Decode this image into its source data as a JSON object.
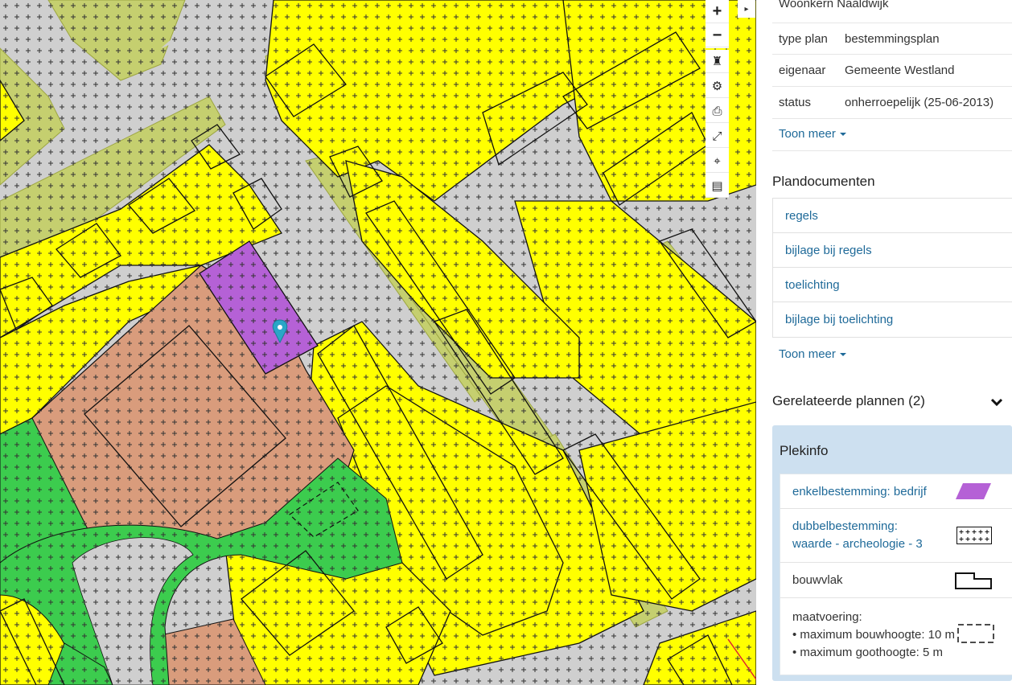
{
  "map": {
    "controls": [
      {
        "name": "zoom-in-button",
        "label": "+",
        "big": true
      },
      {
        "name": "zoom-out-button",
        "label": "−",
        "big": true
      },
      {
        "name": "castle-layer-button",
        "label": "♜",
        "big": false
      },
      {
        "name": "settings-button",
        "label": "⚙",
        "big": false
      },
      {
        "name": "print-button",
        "label": "⎙",
        "big": false
      },
      {
        "name": "fullscreen-button",
        "label": "⤢",
        "big": false
      },
      {
        "name": "locate-button",
        "label": "⌖",
        "big": false
      },
      {
        "name": "legend-button",
        "label": "▤",
        "big": false
      }
    ],
    "collapse_icon": "▸",
    "colors": {
      "road": "#cfcfcf",
      "residential": "#ffff00",
      "business": "#b561d6",
      "centre": "#d99c7c",
      "greenery": "#3ccc4e",
      "mixed": "#c5cf6a",
      "grid": "#333333",
      "outline": "#111111",
      "marker": "#2aa6c7"
    }
  },
  "panel": {
    "plan_name": "Woonkern Naaldwijk",
    "rows": [
      {
        "key": "type plan",
        "value": "bestemmingsplan"
      },
      {
        "key": "eigenaar",
        "value": "Gemeente Westland"
      },
      {
        "key": "status",
        "value": "onherroepelijk (25-06-2013)"
      }
    ],
    "toon_meer_1": "Toon meer",
    "plandocumenten_title": "Plandocumenten",
    "documents": [
      "regels",
      "bijlage bij regels",
      "toelichting",
      "bijlage bij toelichting"
    ],
    "toon_meer_2": "Toon meer",
    "related_title": "Gerelateerde plannen (2)",
    "plekinfo": {
      "title": "Plekinfo",
      "enkelbestemming": "enkelbestemming: bedrijf",
      "dubbel_line1": "dubbelbestemming:",
      "dubbel_line2": "waarde - archeologie - 3",
      "bouwvlak": "bouwvlak",
      "maat_title": "maatvoering:",
      "maat_1": "• maximum bouwhoogte: 10 m",
      "maat_2": "• maximum goothoogte: 5 m",
      "swatch_color": "#b561d6"
    }
  }
}
